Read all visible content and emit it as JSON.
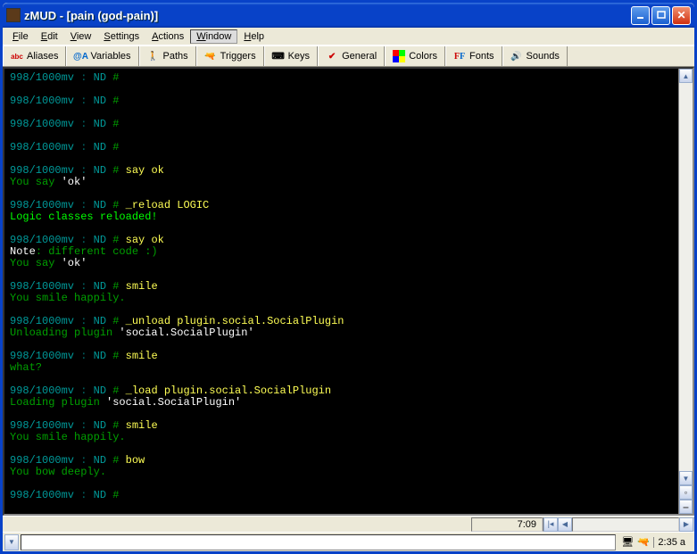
{
  "title": "zMUD - [pain (god-pain)]",
  "menus": {
    "file": "File",
    "edit": "Edit",
    "view": "View",
    "settings": "Settings",
    "actions": "Actions",
    "window": "Window",
    "help": "Help"
  },
  "toolbar": {
    "aliases": "Aliases",
    "variables": "Variables",
    "paths": "Paths",
    "triggers": "Triggers",
    "keys": "Keys",
    "general": "General",
    "colors": "Colors",
    "fonts": "Fonts",
    "sounds": "Sounds"
  },
  "prompt_mv": "998/1000mv",
  "prompt_sep": " : ",
  "prompt_nd": "ND",
  "hash": " #",
  "lines": {
    "say_ok": " say ok",
    "you_say": "You say ",
    "ok_q": "'ok'",
    "reload": " _reload LOGIC",
    "logic": "Logic classes reloaded!",
    "note": "Note",
    "diff_code": ": different code :)",
    "smile": " smile",
    "smile_happy": "You smile happily.",
    "unload": " _unload plugin.social.SocialPlugin",
    "unloading": "Unloading plugin ",
    "social_q": "'social.SocialPlugin'",
    "what": "what?",
    "load": " _load plugin.social.SocialPlugin",
    "loading": "Loading plugin ",
    "bow_cmd": " bow",
    "bow": "You bow deeply."
  },
  "status": {
    "time": "7:09"
  },
  "tray": {
    "clock": "2:35 a"
  }
}
